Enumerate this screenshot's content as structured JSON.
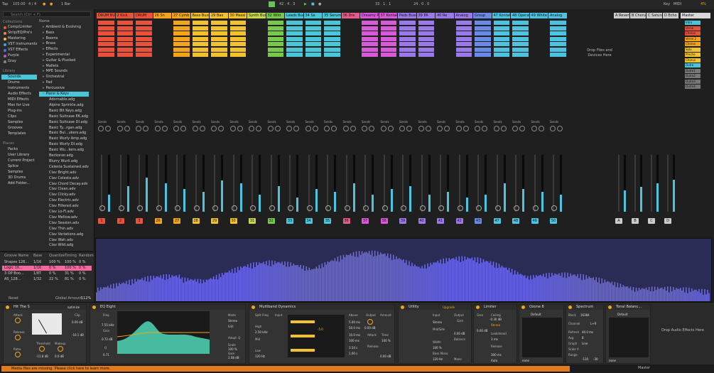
{
  "transport": {
    "tap": "Tap",
    "tempo": "105.00",
    "signature": "4 / 4",
    "quantize": "1 Bar",
    "position": "42 .  4 .  3",
    "loop_start": "33 .  1 .  1",
    "loop_length": "24 .  0 .  0",
    "key": "Key",
    "midi": "MIDI",
    "cpu": "4%"
  },
  "browser": {
    "search_placeholder": "Search (Ctrl + F)",
    "collections_header": "Collections",
    "collections": [
      {
        "label": "Comp/Limiter",
        "color": "#e05a3a"
      },
      {
        "label": "Strip/EQ/Pre's",
        "color": "#f28c28"
      },
      {
        "label": "Mastering",
        "color": "#f2c12e"
      },
      {
        "label": "VST Instruments",
        "color": "#3aa0f0"
      },
      {
        "label": "VST Effects",
        "color": "#4a74e0"
      },
      {
        "label": "Purple",
        "color": "#b05cd8"
      },
      {
        "label": "Gray",
        "color": "#888888"
      }
    ],
    "library_header": "Library",
    "library": [
      "Sounds",
      "Drums",
      "Instruments",
      "Audio Effects",
      "MIDI Effects",
      "Max for Live",
      "Plug-ins",
      "Clips",
      "Samples",
      "Grooves",
      "Templates"
    ],
    "places_header": "Places",
    "places": [
      "Packs",
      "User Library",
      "Current Project",
      "Splice",
      "Samples",
      "3D Drums",
      "Add Folder..."
    ],
    "name_header": "Name",
    "categories": [
      "Ambient & Evolving",
      "Bass",
      "Booms",
      "Brass",
      "Effects",
      "Experimental",
      "Guitar & Plucked",
      "Mallets",
      "MPE Sounds",
      "Orchestral",
      "Pad",
      "Percussive",
      "Piano & Keys"
    ],
    "files": [
      "Adornable.adg",
      "Alpine Sprinkle.adg",
      "Basic Bit Keys.adg",
      "Basic Suitcase EK.adg",
      "Basic Suitcase DI.adg",
      "Basic Ty...rgan.adg",
      "Basic Bul...ukers.adg",
      "Basic Wurly Amp.adg",
      "Basic Wurly DI.adg",
      "Basic Wu...kers.adg",
      "Beckoner.adg",
      "Blurry Wurli.adg",
      "Celesta Sustained.adv",
      "Clav Bright.adv",
      "Clav Celesta.adv",
      "Clav Chord Decay.adv",
      "Clav Clean.adv",
      "Clav Clicky.adv",
      "Clav Electric.adv",
      "Clav Filtered.adv",
      "Clav Lo-Fi.adv",
      "Clav Mellow.adv",
      "Clav Session.adv",
      "Clav Thin.adv",
      "Clav Variations.adg",
      "Clav Wah.adv",
      "Clav Wild.adg"
    ]
  },
  "groove": {
    "headers": [
      "Groove Name",
      "Base",
      "Quantize",
      "Timing",
      "Random"
    ],
    "rows": [
      [
        "Shapes 126...",
        "1/16",
        "100 %",
        "100 %",
        "0 %"
      ],
      [
        "Logic 16...",
        "1/16",
        "0 %",
        "100 %",
        "0 %"
      ],
      [
        "3 OP Boo...",
        "1/8T",
        "0 %",
        "31 %",
        "0 %"
      ],
      [
        "AS_128...",
        "1/32",
        "22 %",
        "81 %",
        "0 %"
      ]
    ],
    "global_label": "Global Amount",
    "global_value": "112%",
    "reset_label": "Reset"
  },
  "tracks": [
    {
      "name": "DRUM BU",
      "color": "#e8523a",
      "num": "1"
    },
    {
      "name": "2 Kick",
      "color": "#e8523a",
      "num": "2"
    },
    {
      "name": "DRUM",
      "color": "#e8523a",
      "num": "3"
    },
    {
      "name": "26 Sn",
      "color": "#f2a51a",
      "num": "26"
    },
    {
      "name": "27 Cymb",
      "color": "#f2a51a",
      "num": "27"
    },
    {
      "name": "Bass Buss",
      "color": "#f2c12e",
      "num": "28"
    },
    {
      "name": "29 Bas",
      "color": "#f2c12e",
      "num": "29"
    },
    {
      "name": "30 Massi",
      "color": "#f2c12e",
      "num": "30"
    },
    {
      "name": "Synth Buss",
      "color": "#c6d84a",
      "num": "31"
    },
    {
      "name": "32 Wild",
      "color": "#78c84a",
      "num": "32"
    },
    {
      "name": "Leads Buss",
      "color": "#49c6d8",
      "num": "33"
    },
    {
      "name": "34 Se",
      "color": "#49c6d8",
      "num": "34"
    },
    {
      "name": "35 Serum",
      "color": "#49c6d8",
      "num": "35"
    },
    {
      "name": "36 Dre",
      "color": "#e85a8a",
      "num": "36"
    },
    {
      "name": "Dreamy P",
      "color": "#d85ad8",
      "num": "37"
    },
    {
      "name": "37 Kontak",
      "color": "#d85ad8",
      "num": "38"
    },
    {
      "name": "Pads Buss",
      "color": "#9a7ae8",
      "num": "39"
    },
    {
      "name": "39 PA",
      "color": "#9a7ae8",
      "num": "40"
    },
    {
      "name": "40 Re",
      "color": "#9a7ae8",
      "num": "41"
    },
    {
      "name": "Analog",
      "color": "#9a7ae8",
      "num": "42"
    },
    {
      "name": "Group",
      "color": "#6a8ae8",
      "num": "43"
    },
    {
      "name": "47 Kontakt",
      "color": "#4ec3e0",
      "num": "47"
    },
    {
      "name": "48 Operator",
      "color": "#4ec3e0",
      "num": "48"
    },
    {
      "name": "49 White Light",
      "color": "#4ec3e0",
      "num": "49"
    },
    {
      "name": "Analog",
      "color": "#4ec3e0",
      "num": "50"
    }
  ],
  "returns": [
    {
      "name": "A Reverb",
      "color": "#cccccc",
      "num": "A"
    },
    {
      "name": "B Chorus",
      "color": "#cccccc",
      "num": "B"
    },
    {
      "name": "C Satura",
      "color": "#cccccc",
      "num": "C"
    },
    {
      "name": "D Echo",
      "color": "#cccccc",
      "num": "D"
    }
  ],
  "master": {
    "label": "Master",
    "scenes": [
      {
        "label": "Intro",
        "color": "#49c6d8"
      },
      {
        "label": "Verse",
        "color": "#e8523a"
      },
      {
        "label": "Chorus",
        "color": "#e8523a"
      },
      {
        "label": "Verse 2",
        "color": "#f2a51a"
      },
      {
        "label": "Chorus",
        "color": "#f2a51a"
      },
      {
        "label": "Solo",
        "color": "#f2c12e"
      },
      {
        "label": "Precho",
        "color": "#f2c12e"
      },
      {
        "label": "Chorus",
        "color": "#f2c12e"
      },
      {
        "label": "Outro",
        "color": "#49c6d8"
      },
      {
        "label": "Outro1",
        "color": "#777777"
      },
      {
        "label": "Outro2",
        "color": "#777777"
      },
      {
        "label": "Outro3",
        "color": "#777777"
      },
      {
        "label": "Outro4",
        "color": "#777777"
      }
    ]
  },
  "drop_zone": "Drop Files and Devices Here",
  "sends_label": "Sends",
  "devices": {
    "hit_the_s": {
      "title": "Hit The S",
      "preset": "optimize",
      "attack": "Attack",
      "release": "Release",
      "ratio": "Ratio",
      "threshold": "Threshold",
      "threshold_val": "-11.8 dB",
      "makeup": "Makeup",
      "makeup_val": "0.0 dB",
      "clip": "Clip",
      "clip_val": "0.00 dB",
      "out_val": "-10.1 dB"
    },
    "eq_eight": {
      "title": "EQ Eight",
      "freq": "Freq",
      "freq_val": "7.55 kHz",
      "gain": "Gain",
      "gain_val": "0.72 dB",
      "q": "Q",
      "q_val": "0.71",
      "mode": "Mode",
      "mode_val": "Stereo",
      "edit": "Edit",
      "scale": "Scale",
      "scale_val": "100 %",
      "gain_out": "Gain",
      "gain_out_val": "2.08 dB",
      "adapt": "Adapt. Q"
    },
    "multiband": {
      "title": "Multiband Dynamics",
      "split": "Split Freq",
      "input": "Input",
      "high": "High",
      "mid": "Mid",
      "low": "Low",
      "high_freq": "2.50 kHz",
      "low_freq": "120 Hz",
      "above": "Above",
      "below": "Below",
      "output": "Output",
      "amount": "Amount",
      "attack": "Attack",
      "release": "Release",
      "time": "Time",
      "vals": [
        "5.00 ms",
        "50.0 ms",
        "10.0 ms",
        "100 ms",
        "3.54 s",
        "1.00 s"
      ],
      "out_val": "0.00 dB",
      "amount_val": "0.00 dB",
      "time_val": "100 %",
      "peak": "-5.0"
    },
    "utility": {
      "title": "Utility",
      "input": "Input",
      "output": "Output",
      "gain": "Gain",
      "gain_val": "0.00 dB",
      "width": "Width",
      "width_val": "100 %",
      "mono": "Mono",
      "bass_mono": "Bass Mono",
      "freq_val": "120 Hz",
      "balance": "Balance",
      "mode": "Stereo",
      "ms": "Mid/Side",
      "upgrade": "Upgrade"
    },
    "limiter": {
      "title": "Limiter",
      "gain": "Gain",
      "gain_val": "0.00 dB",
      "ceiling": "Ceiling",
      "ceiling_val": "-0.30 dB",
      "stereo": "Stereo",
      "lookahead": "Lookahead",
      "lookahead_val": "3 ms",
      "release": "Release",
      "release_val": "300 ms",
      "auto": "Auto"
    },
    "ozone": {
      "title": "Ozone 8",
      "preset": "Default",
      "none": "none"
    },
    "spectrum": {
      "title": "Spectrum",
      "block": "Block",
      "block_val": "16384",
      "channel": "Channel",
      "channel_val": "L+R",
      "refresh": "Refresh",
      "refresh_val": "40.0 ms",
      "avg": "Avg",
      "avg_val": "8",
      "graph": "Graph",
      "graph_val": "Line",
      "scale_x": "Scale X",
      "range": "Range",
      "range_lo": "-120",
      "range_hi": "-30"
    },
    "tonal": {
      "title": "Tonal Balanc...",
      "preset": "Default",
      "none": "none"
    },
    "drop_text": "Drop Audio Effects Here"
  },
  "status": {
    "message": "Media files are missing. Please click here to learn more.",
    "right_label": "Master"
  }
}
